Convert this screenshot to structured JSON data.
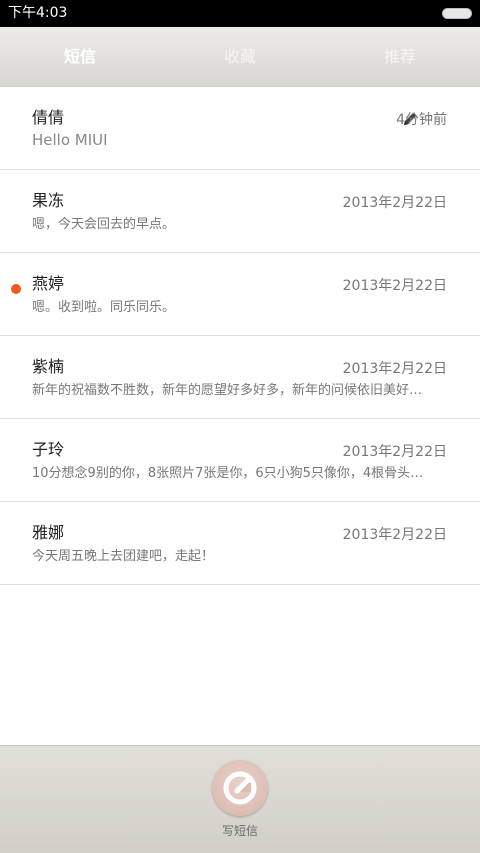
{
  "status": {
    "time": "下午4:03"
  },
  "tabs": [
    {
      "label": "短信"
    },
    {
      "label": "收藏"
    },
    {
      "label": "推荐"
    }
  ],
  "messages": [
    {
      "name": "倩倩",
      "date": "4分钟前",
      "preview": "Hello MIUI",
      "unread": false,
      "draft": true
    },
    {
      "name": "果冻",
      "date": "2013年2月22日",
      "preview": "嗯，今天会回去的早点。",
      "unread": false,
      "draft": false
    },
    {
      "name": "燕婷",
      "date": "2013年2月22日",
      "preview": "嗯。收到啦。同乐同乐。",
      "unread": true,
      "draft": false
    },
    {
      "name": "紫楠",
      "date": "2013年2月22日",
      "preview": "新年的祝福数不胜数，新年的愿望好多好多，新年的问候依旧美好…",
      "unread": false,
      "draft": false
    },
    {
      "name": "子玲",
      "date": "2013年2月22日",
      "preview": "10分想念9别的你，8张照片7张是你，6只小狗5只像你，4根骨头…",
      "unread": false,
      "draft": false
    },
    {
      "name": "雅娜",
      "date": "2013年2月22日",
      "preview": "今天周五晚上去团建吧，走起！",
      "unread": false,
      "draft": false
    }
  ],
  "compose": {
    "label": "写短信"
  },
  "colors": {
    "accent": "#f35b1e",
    "tabbar": "#dedcd7",
    "compose_button": "#dcbdb4"
  }
}
